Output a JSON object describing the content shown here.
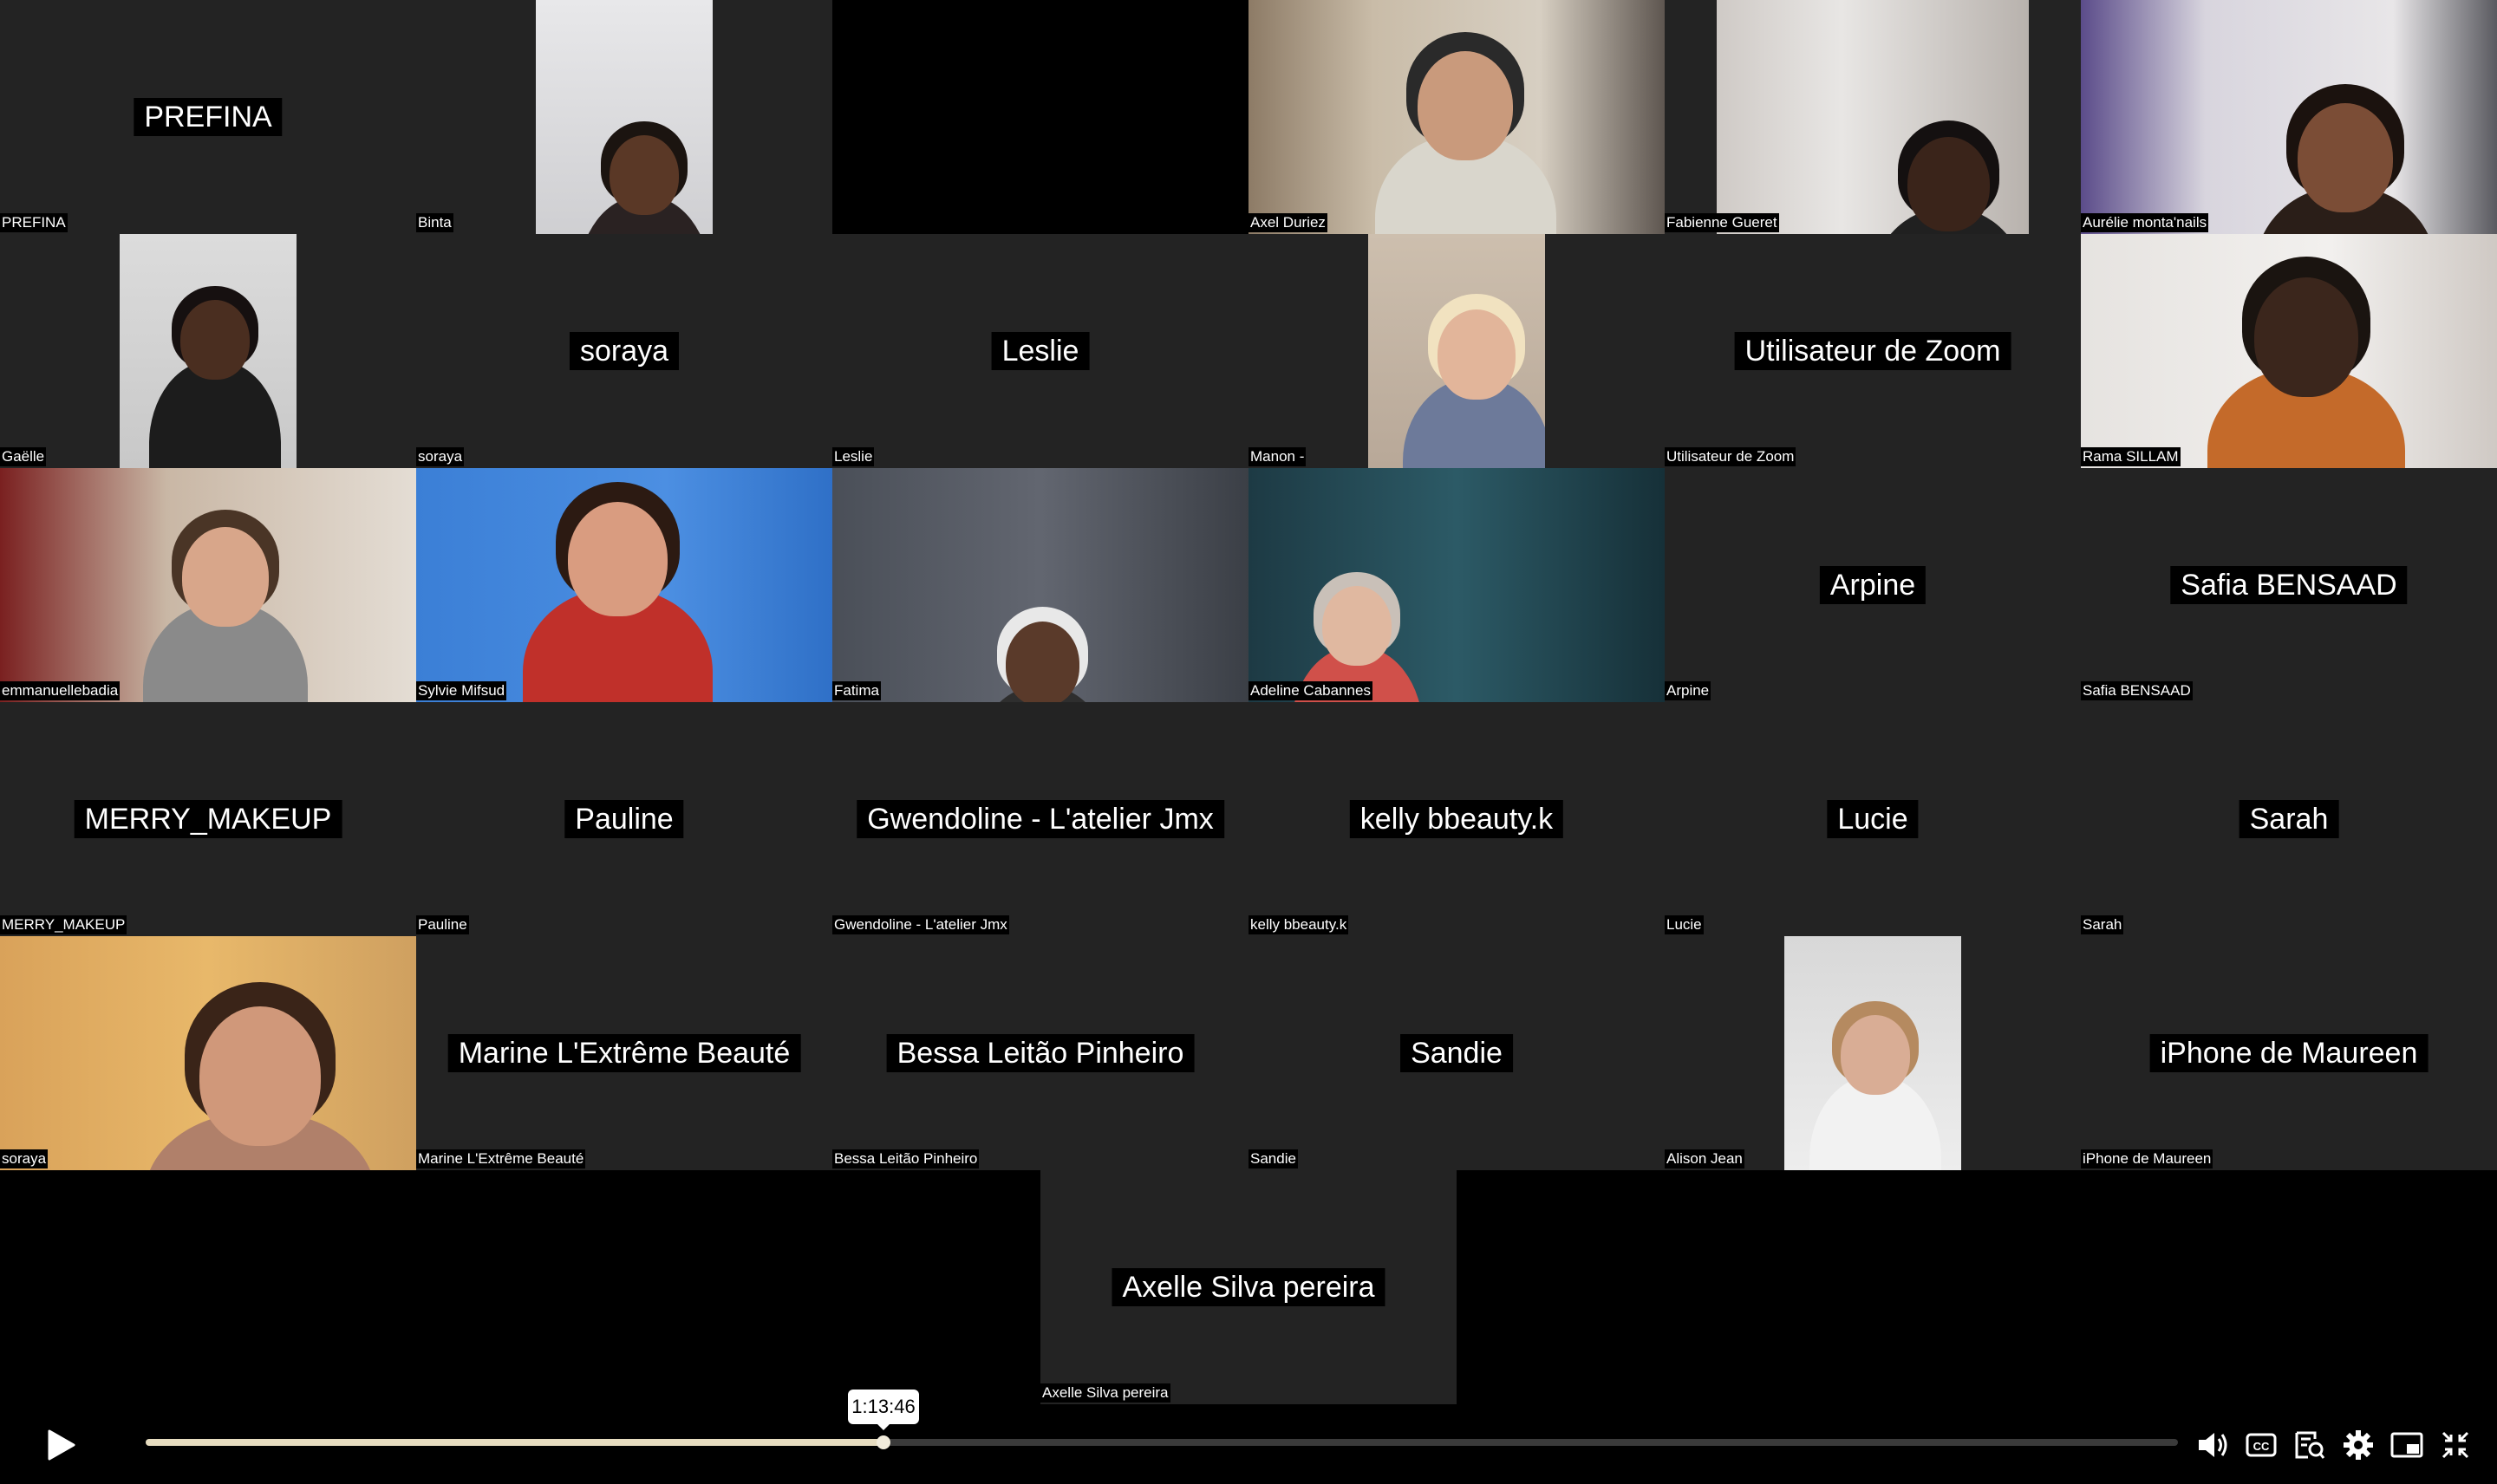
{
  "tiles": [
    {
      "row": 0,
      "col": 0,
      "label": "PREFINA",
      "center": "PREFINA",
      "video": false
    },
    {
      "row": 0,
      "col": 1,
      "label": "Binta",
      "center": "",
      "video": true
    },
    {
      "row": 0,
      "col": 2,
      "label": "",
      "center": "",
      "video": false,
      "black": true
    },
    {
      "row": 0,
      "col": 3,
      "label": "Axel Duriez",
      "center": "",
      "video": true
    },
    {
      "row": 0,
      "col": 4,
      "label": "Fabienne Gueret",
      "center": "",
      "video": true
    },
    {
      "row": 0,
      "col": 5,
      "label": "Aurélie monta'nails",
      "center": "",
      "video": true
    },
    {
      "row": 1,
      "col": 0,
      "label": "Gaëlle",
      "center": "",
      "video": true
    },
    {
      "row": 1,
      "col": 1,
      "label": "soraya",
      "center": "soraya",
      "video": false
    },
    {
      "row": 1,
      "col": 2,
      "label": "Leslie",
      "center": "Leslie",
      "video": false
    },
    {
      "row": 1,
      "col": 3,
      "label": "Manon -",
      "center": "",
      "video": true
    },
    {
      "row": 1,
      "col": 4,
      "label": "Utilisateur de Zoom",
      "center": "Utilisateur de Zoom",
      "video": false
    },
    {
      "row": 1,
      "col": 5,
      "label": "Rama SILLAM",
      "center": "",
      "video": true
    },
    {
      "row": 2,
      "col": 0,
      "label": "emmanuellebadia",
      "center": "",
      "video": true
    },
    {
      "row": 2,
      "col": 1,
      "label": "Sylvie Mifsud",
      "center": "",
      "video": true
    },
    {
      "row": 2,
      "col": 2,
      "label": "Fatima",
      "center": "",
      "video": true
    },
    {
      "row": 2,
      "col": 3,
      "label": "Adeline Cabannes",
      "center": "",
      "video": true
    },
    {
      "row": 2,
      "col": 4,
      "label": "Arpine",
      "center": "Arpine",
      "video": false
    },
    {
      "row": 2,
      "col": 5,
      "label": "Safia BENSAAD",
      "center": "Safia BENSAAD",
      "video": false
    },
    {
      "row": 3,
      "col": 0,
      "label": "MERRY_MAKEUP",
      "center": "MERRY_MAKEUP",
      "video": false
    },
    {
      "row": 3,
      "col": 1,
      "label": "Pauline",
      "center": "Pauline",
      "video": false
    },
    {
      "row": 3,
      "col": 2,
      "label": "Gwendoline - L'atelier Jmx",
      "center": "Gwendoline - L'atelier Jmx",
      "video": false
    },
    {
      "row": 3,
      "col": 3,
      "label": "kelly bbeauty.k",
      "center": "kelly bbeauty.k",
      "video": false
    },
    {
      "row": 3,
      "col": 4,
      "label": "Lucie",
      "center": "Lucie",
      "video": false
    },
    {
      "row": 3,
      "col": 5,
      "label": "Sarah",
      "center": "Sarah",
      "video": false
    },
    {
      "row": 4,
      "col": 0,
      "label": "soraya",
      "center": "",
      "video": true
    },
    {
      "row": 4,
      "col": 1,
      "label": "Marine L'Extrême Beauté",
      "center": "Marine L'Extrême Beauté",
      "video": false
    },
    {
      "row": 4,
      "col": 2,
      "label": "Bessa Leitão Pinheiro",
      "center": "Bessa Leitão Pinheiro",
      "video": false
    },
    {
      "row": 4,
      "col": 3,
      "label": "Sandie",
      "center": "Sandie",
      "video": false
    },
    {
      "row": 4,
      "col": 4,
      "label": "Alison Jean",
      "center": "",
      "video": true
    },
    {
      "row": 4,
      "col": 5,
      "label": "iPhone de Maureen",
      "center": "iPhone de Maureen",
      "video": false
    },
    {
      "row": 5,
      "col": 2.5,
      "label": "Axelle Silva pereira",
      "center": "Axelle Silva pereira",
      "video": false
    }
  ],
  "player": {
    "timestamp": "1:13:46",
    "progress_fraction": 0.363,
    "colors": {
      "progress": "#e6dcbf",
      "track": "#3a3a3a",
      "tile": "#232323"
    },
    "icons": [
      "play-icon",
      "volume-icon",
      "captions-icon",
      "transcript-icon",
      "settings-icon",
      "picture-in-picture-icon",
      "exit-fullscreen-icon"
    ]
  }
}
